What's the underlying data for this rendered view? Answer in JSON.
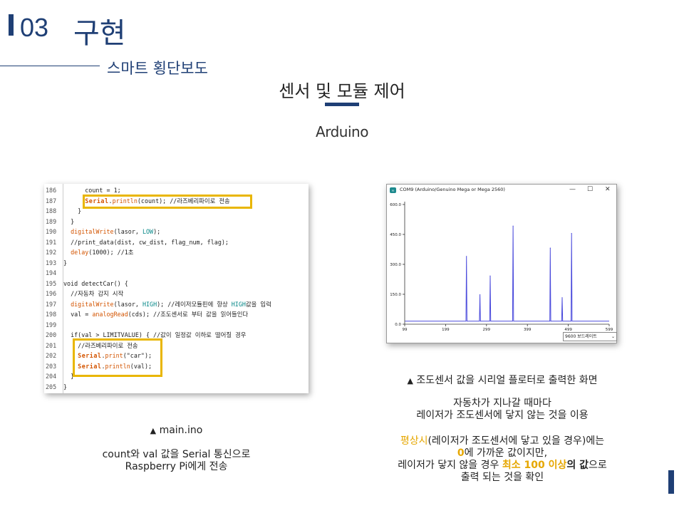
{
  "header": {
    "section_number": "03",
    "section_title": "구현",
    "subtitle": "스마트 횡단보도",
    "topic": "센서 및 모듈 제어",
    "platform": "Arduino"
  },
  "code": {
    "lines": [
      {
        "n": "186",
        "text": "      count = 1;"
      },
      {
        "n": "187",
        "text": "      Serial.println(count); //라즈베리파이로 전송"
      },
      {
        "n": "188",
        "text": "    }"
      },
      {
        "n": "189",
        "text": "  }"
      },
      {
        "n": "190",
        "text": "  digitalWrite(lasor, LOW);"
      },
      {
        "n": "191",
        "text": "  //print_data(dist, cw_dist, flag_num, flag);"
      },
      {
        "n": "192",
        "text": "  delay(1000); //1초"
      },
      {
        "n": "193",
        "text": "}"
      },
      {
        "n": "194",
        "text": ""
      },
      {
        "n": "195",
        "text": "void detectCar() {"
      },
      {
        "n": "196",
        "text": "  //자동차 감지 시작"
      },
      {
        "n": "197",
        "text": "  digitalWrite(lasor, HIGH); //레이저모듈핀에 항상 HIGH값을 입력"
      },
      {
        "n": "198",
        "text": "  val = analogRead(cds); //조도센서로 부터 값을 읽어들인다"
      },
      {
        "n": "199",
        "text": ""
      },
      {
        "n": "200",
        "text": "  if(val > LIMITVALUE) { //값이 일정값 이하로 떨어질 경우"
      },
      {
        "n": "201",
        "text": "    //라즈베리파이로 전송"
      },
      {
        "n": "202",
        "text": "    Serial.print(\"car\");"
      },
      {
        "n": "203",
        "text": "    Serial.println(val);"
      },
      {
        "n": "204",
        "text": "  }"
      },
      {
        "n": "205",
        "text": "}"
      }
    ],
    "caption": "main.ino",
    "description_line1": "count와 val 값을 Serial 통신으로",
    "description_line2": "Raspberry Pi에게 전송"
  },
  "plotter": {
    "window_title": "COM9 (Arduino/Genuino Mega or Mega 2560)",
    "baud_rate": "9600 보드레이트",
    "minimize": "—",
    "maximize": "☐",
    "close": "✕",
    "caption": "조도센서 값을 시리얼 플로터로 출력한 화면",
    "line_color": "#4b4bdc",
    "chart_data": {
      "type": "line",
      "title": "",
      "xlabel": "",
      "ylabel": "",
      "xlim": [
        99,
        599
      ],
      "ylim": [
        0,
        600
      ],
      "x_ticks": [
        "99",
        "199",
        "299",
        "399",
        "499",
        "599"
      ],
      "y_ticks": [
        "0.0",
        "150.0",
        "300.0",
        "450.0",
        "600.0"
      ],
      "baseline": 15,
      "spikes": [
        {
          "x": 250,
          "y": 340
        },
        {
          "x": 283,
          "y": 148
        },
        {
          "x": 308,
          "y": 242
        },
        {
          "x": 364,
          "y": 492
        },
        {
          "x": 455,
          "y": 382
        },
        {
          "x": 484,
          "y": 133
        },
        {
          "x": 507,
          "y": 455
        }
      ]
    }
  },
  "notes": {
    "line1": "자동차가 지나갈 때마다",
    "line2": "레이저가 조도센서에 닿지 않는 것을 이용",
    "p1_a": "평상시",
    "p1_b": "(레이저가 조도센서에 닿고 있을 경우)에는",
    "p2_a": "0",
    "p2_b": "에 가까운 값이지만,",
    "p3_a": "레이저가 닿지 않을 경우 ",
    "p3_b": "최소 100 이상",
    "p3_c": "의 값",
    "p3_d": "으로",
    "p4": "출력 되는 것을 확인"
  }
}
